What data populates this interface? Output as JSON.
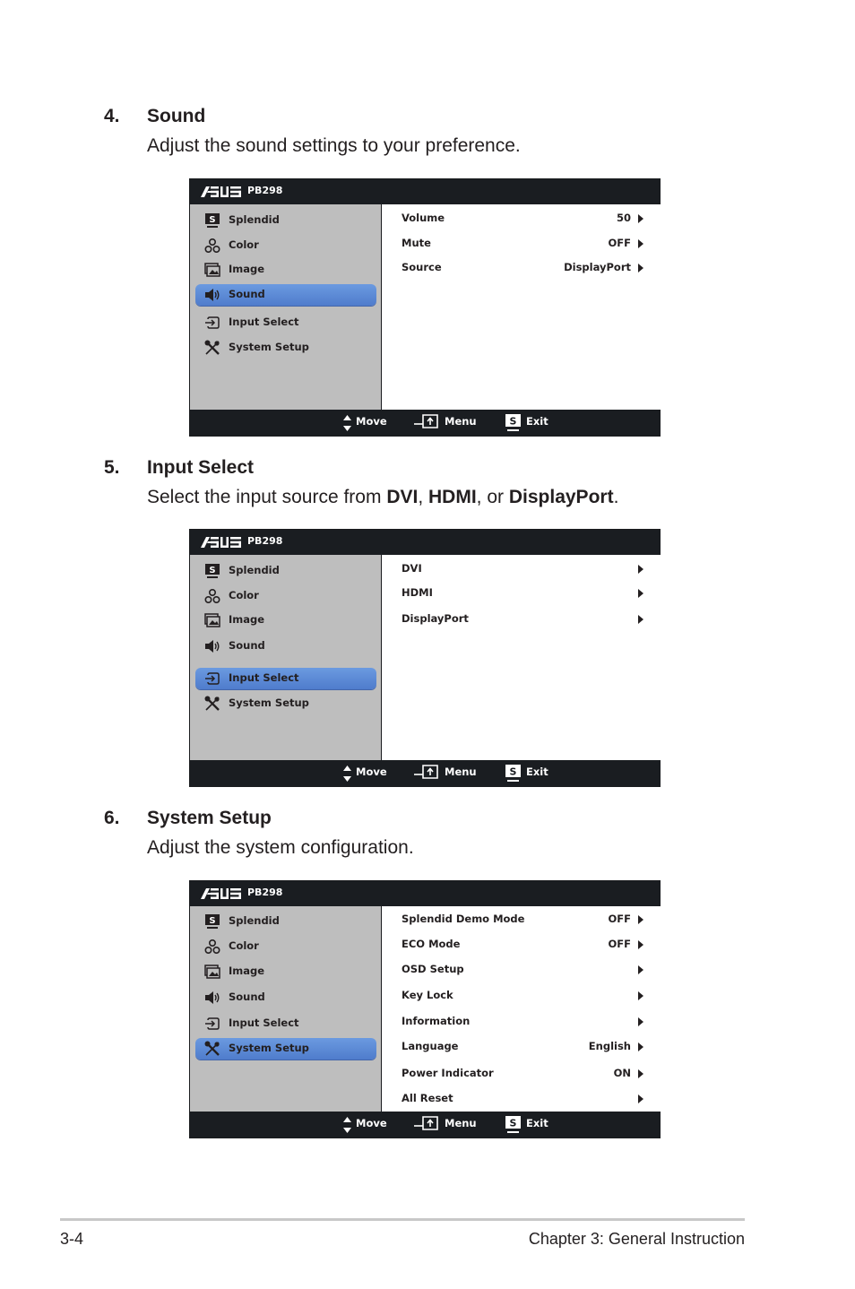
{
  "sections": [
    {
      "number": "4.",
      "title": "Sound",
      "description_parts": [
        {
          "text": "Adjust the sound settings to your preference.",
          "bold": false
        }
      ]
    },
    {
      "number": "5.",
      "title": "Input Select",
      "description_parts": [
        {
          "text": "Select the input source from ",
          "bold": false
        },
        {
          "text": "DVI",
          "bold": true
        },
        {
          "text": ", ",
          "bold": false
        },
        {
          "text": "HDMI",
          "bold": true
        },
        {
          "text": ", or ",
          "bold": false
        },
        {
          "text": "DisplayPort",
          "bold": true
        },
        {
          "text": ".",
          "bold": false
        }
      ]
    },
    {
      "number": "6.",
      "title": "System Setup",
      "description_parts": [
        {
          "text": "Adjust the system configuration.",
          "bold": false
        }
      ]
    }
  ],
  "osd_common": {
    "brand": "ASUS",
    "model": "PB298",
    "menu": [
      {
        "label": "Splendid",
        "icon": "splendid-icon"
      },
      {
        "label": "Color",
        "icon": "color-icon"
      },
      {
        "label": "Image",
        "icon": "image-icon"
      },
      {
        "label": "Sound",
        "icon": "sound-icon"
      },
      {
        "label": "Input Select",
        "icon": "input-select-icon"
      },
      {
        "label": "System Setup",
        "icon": "system-setup-icon"
      }
    ],
    "footer": {
      "move": "Move",
      "menu": "Menu",
      "exit": "Exit",
      "exit_key": "S"
    },
    "colors": {
      "header_bg": "#1a1d21",
      "sidebar_bg": "#bebebe",
      "highlight": "#5a88d6",
      "content_bg": "#ffffff"
    }
  },
  "osd_screens": [
    {
      "active": "Sound",
      "options": [
        {
          "label": "Volume",
          "value": "50"
        },
        {
          "label": "Mute",
          "value": "OFF"
        },
        {
          "label": "Source",
          "value": "DisplayPort"
        }
      ]
    },
    {
      "active": "Input Select",
      "options": [
        {
          "label": "DVI",
          "value": ""
        },
        {
          "label": "HDMI",
          "value": ""
        },
        {
          "label": "DisplayPort",
          "value": ""
        }
      ]
    },
    {
      "active": "System Setup",
      "options": [
        {
          "label": "Splendid Demo Mode",
          "value": "OFF"
        },
        {
          "label": "ECO Mode",
          "value": "OFF"
        },
        {
          "label": "OSD Setup",
          "value": ""
        },
        {
          "label": "Key Lock",
          "value": ""
        },
        {
          "label": "Information",
          "value": ""
        },
        {
          "label": "Language",
          "value": "English"
        },
        {
          "label": "Power Indicator",
          "value": "ON"
        },
        {
          "label": "All Reset",
          "value": ""
        }
      ]
    }
  ],
  "page_footer": {
    "page_number": "3-4",
    "chapter": "Chapter 3: General Instruction"
  }
}
